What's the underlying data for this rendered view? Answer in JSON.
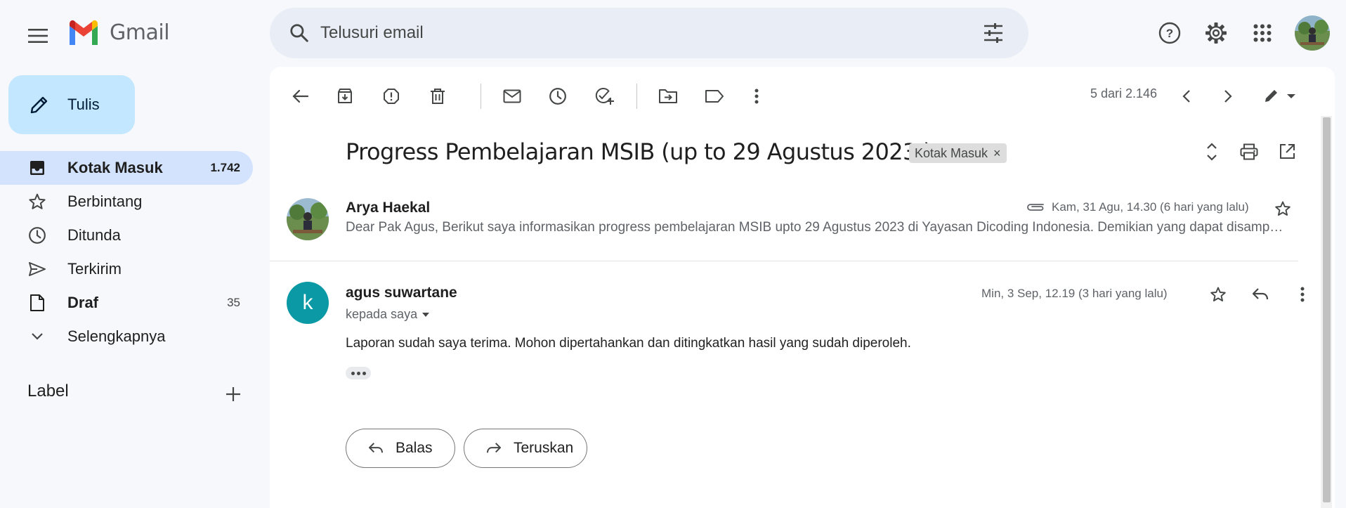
{
  "app": {
    "name": "Gmail"
  },
  "search": {
    "placeholder": "Telusuri email"
  },
  "compose": {
    "label": "Tulis"
  },
  "sidebar": {
    "items": [
      {
        "label": "Kotak Masuk",
        "count": "1.742",
        "icon": "inbox-icon",
        "active": true,
        "bold": true
      },
      {
        "label": "Berbintang",
        "count": "",
        "icon": "star-icon"
      },
      {
        "label": "Ditunda",
        "count": "",
        "icon": "clock-icon"
      },
      {
        "label": "Terkirim",
        "count": "",
        "icon": "send-icon"
      },
      {
        "label": "Draf",
        "count": "35",
        "icon": "draft-icon",
        "bold": true
      },
      {
        "label": "Selengkapnya",
        "count": "",
        "icon": "chevron-down-icon"
      }
    ],
    "labels_header": "Label"
  },
  "toolbar": {
    "pager": "5 dari 2.146"
  },
  "email": {
    "subject": "Progress Pembelajaran MSIB (up to 29 Agustus 2023 )",
    "label_chip": "Kotak Masuk",
    "label_chip_close": "×",
    "messages": [
      {
        "sender": "Arya Haekal",
        "date": "Kam, 31 Agu, 14.30 (6 hari yang lalu)",
        "snippet": "Dear Pak Agus, Berikut saya informasikan progress pembelajaran MSIB upto 29 Agustus 2023 di Yayasan Dicoding Indonesia. Demikian yang dapat disampaikan. Terima kasih."
      },
      {
        "sender": "agus suwartane",
        "avatar_letter": "k",
        "avatar_color": "#0b9aa5",
        "to": "kepada saya",
        "date": "Min, 3 Sep, 12.19 (3 hari yang lalu)",
        "body": "Laporan sudah saya terima. Mohon dipertahankan dan ditingkatkan hasil yang sudah diperoleh."
      }
    ]
  },
  "actions": {
    "reply": "Balas",
    "forward": "Teruskan"
  },
  "colors": {
    "accent": "#c2e7ff",
    "active_nav": "#d3e3fd",
    "background": "#f6f8fc"
  }
}
